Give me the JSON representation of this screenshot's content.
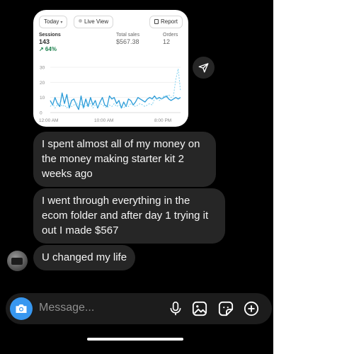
{
  "shared_screenshot": {
    "filter_today": "Today",
    "filter_live": "Live View",
    "report_label": "Report",
    "sessions": {
      "label": "Sessions",
      "value": "143",
      "change": "↗ 64%"
    },
    "total_sales": {
      "label": "Total sales",
      "value": "$567.38"
    },
    "orders": {
      "label": "Orders",
      "value": "12"
    },
    "chart_data": {
      "type": "line",
      "y_ticks": [
        "30",
        "20",
        "10",
        "0"
      ],
      "ylim": [
        0,
        30
      ],
      "x_ticks": [
        "12:00 AM",
        "10:00 AM",
        "8:00 PM"
      ],
      "series": [
        {
          "style": "solid",
          "color": "#2a9bd8",
          "values": [
            8,
            5,
            10,
            6,
            4,
            13,
            6,
            12,
            3,
            8,
            9,
            5,
            2,
            11,
            3,
            9,
            4,
            10,
            5,
            8,
            3,
            7,
            10,
            5,
            4,
            11,
            9,
            10,
            6,
            8,
            3,
            7,
            4,
            9,
            8,
            5,
            7,
            10,
            9,
            8,
            7,
            9,
            10,
            9,
            11,
            9,
            10,
            9,
            10,
            11,
            9,
            8,
            9,
            10,
            9,
            10
          ]
        },
        {
          "style": "dashed",
          "color": "#7ed0ef",
          "values": [
            4,
            6,
            3,
            5,
            7,
            4,
            5,
            3,
            6,
            4,
            5,
            7,
            4,
            6,
            3,
            5,
            4,
            6,
            3,
            5,
            4,
            6,
            5,
            4,
            3,
            5,
            4,
            6,
            4,
            5,
            4,
            3,
            5,
            4,
            6,
            5,
            4,
            5,
            6,
            5,
            4,
            5,
            6,
            5,
            9,
            10,
            8,
            9,
            11,
            10,
            12,
            10,
            11,
            22,
            29,
            14
          ]
        }
      ]
    }
  },
  "messages": [
    {
      "text": "I spent almost all of my money on the money making starter kit 2 weeks ago"
    },
    {
      "text": "I went through everything in the ecom folder and after day 1 trying it out I made $567"
    },
    {
      "text": "U changed my life"
    }
  ],
  "composer": {
    "placeholder": "Message..."
  },
  "icons": {
    "share": "paper-plane-icon",
    "camera": "camera-icon",
    "mic": "microphone-icon",
    "gallery": "image-icon",
    "sticker": "sticker-icon",
    "plus": "plus-circle-icon"
  },
  "colors": {
    "accent": "#3797f0",
    "bubble": "#262626",
    "background": "#000000"
  }
}
